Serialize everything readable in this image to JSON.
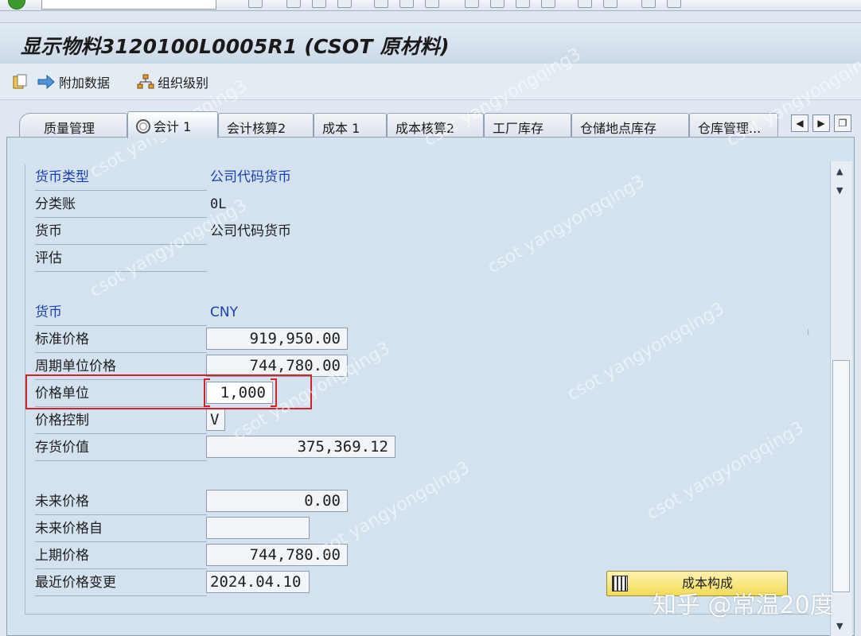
{
  "title": "显示物料3120100L0005R1 (CSOT 原材料)",
  "toolbar": {
    "additional_data": "附加数据",
    "org_levels": "组织级别"
  },
  "tabs": [
    {
      "label": "质量管理"
    },
    {
      "label": "会计 1",
      "active": true
    },
    {
      "label": "会计核算2"
    },
    {
      "label": "成本 1"
    },
    {
      "label": "成本核算2"
    },
    {
      "label": "工厂库存"
    },
    {
      "label": "仓储地点库存"
    },
    {
      "label": "仓库管理..."
    }
  ],
  "fields": {
    "currency_type": {
      "label": "货币类型",
      "value": "公司代码货币"
    },
    "ledger": {
      "label": "分类账",
      "value": "0L"
    },
    "currency": {
      "label": "货币",
      "value": "公司代码货币"
    },
    "valuation": {
      "label": "评估",
      "value": ""
    },
    "currency2": {
      "label": "货币",
      "value": "CNY"
    },
    "standard_price": {
      "label": "标准价格",
      "value": "919,950.00"
    },
    "periodic_unit_price": {
      "label": "周期单位价格",
      "value": "744,780.00"
    },
    "price_unit": {
      "label": "价格单位",
      "value": "1,000"
    },
    "price_control": {
      "label": "价格控制",
      "value": "V"
    },
    "inventory_value": {
      "label": "存货价值",
      "value": "375,369.12"
    },
    "future_price": {
      "label": "未来价格",
      "value": "0.00"
    },
    "future_price_from": {
      "label": "未来价格自",
      "value": ""
    },
    "previous_price": {
      "label": "上期价格",
      "value": "744,780.00"
    },
    "last_price_change": {
      "label": "最近价格变更",
      "value": "2024.04.10"
    }
  },
  "cost_button": "成本构成",
  "watermark_text": "csot yangyongqing3",
  "zhihu_watermark": "知乎 @常温20度",
  "colors": {
    "label_blue": "#1a3fb0",
    "highlight_red": "#d3212c",
    "button_yellow": "#f3da57"
  }
}
